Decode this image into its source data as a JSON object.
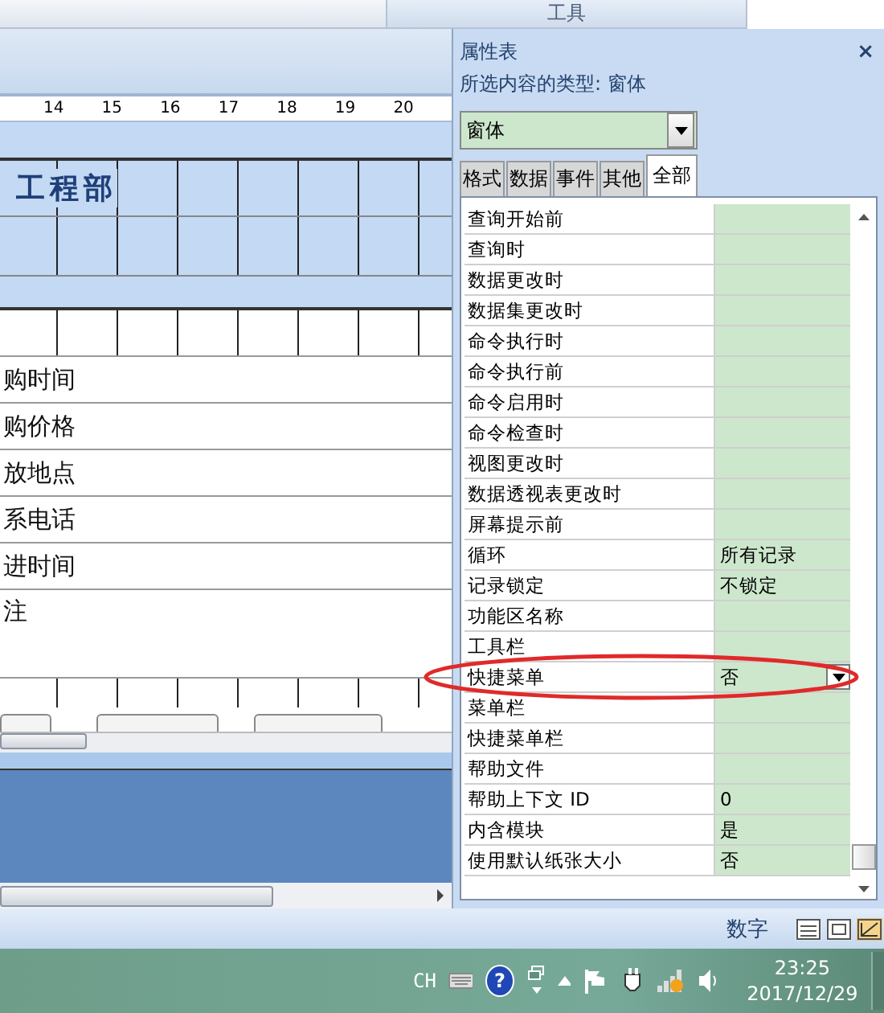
{
  "ribbon": {
    "context_tab": "工具"
  },
  "form_designer": {
    "ruler": [
      "14",
      "15",
      "16",
      "17",
      "18",
      "19",
      "20"
    ],
    "header_title": "工程部",
    "fields": [
      "购时间",
      "购价格",
      "放地点",
      "系电话",
      "进时间",
      "注"
    ]
  },
  "property_sheet": {
    "title": "属性表",
    "close": "×",
    "selection_type": "所选内容的类型: 窗体",
    "object_select": "窗体",
    "tabs": [
      {
        "label": "格式",
        "selected": false
      },
      {
        "label": "数据",
        "selected": false
      },
      {
        "label": "事件",
        "selected": false
      },
      {
        "label": "其他",
        "selected": false
      },
      {
        "label": "全部",
        "selected": true
      }
    ],
    "properties": [
      {
        "name": "查询开始前",
        "kind": "text"
      },
      {
        "name": "查询时",
        "kind": "text"
      },
      {
        "name": "数据更改时",
        "kind": "text"
      },
      {
        "name": "数据集更改时",
        "kind": "text"
      },
      {
        "name": "命令执行时",
        "kind": "text"
      },
      {
        "name": "命令执行前",
        "kind": "text"
      },
      {
        "name": "命令启用时",
        "kind": "text"
      },
      {
        "name": "命令检查时",
        "kind": "text"
      },
      {
        "name": "视图更改时",
        "kind": "text"
      },
      {
        "name": "数据透视表更改时",
        "kind": "text"
      },
      {
        "name": "屏幕提示前",
        "kind": "text"
      },
      {
        "name": "循环",
        "value": "所有记录",
        "kind": "text"
      },
      {
        "name": "记录锁定",
        "value": "不锁定",
        "kind": "text"
      },
      {
        "name": "功能区名称",
        "kind": "text"
      },
      {
        "name": "工具栏",
        "kind": "text"
      },
      {
        "name": "快捷菜单",
        "value": "否",
        "kind": "dropdown"
      },
      {
        "name": "菜单栏",
        "kind": "text"
      },
      {
        "name": "快捷菜单栏",
        "kind": "text"
      },
      {
        "name": "帮助文件",
        "kind": "text"
      },
      {
        "name": "帮助上下文 ID",
        "value": "0",
        "kind": "text"
      },
      {
        "name": "内含模块",
        "value": "是",
        "kind": "text"
      },
      {
        "name": "使用默认纸张大小",
        "value": "否",
        "kind": "text"
      }
    ]
  },
  "status_bar": {
    "mode": "数字"
  },
  "taskbar": {
    "language": "CH",
    "help": "?",
    "time": "23:25",
    "date": "2017/12/29"
  }
}
